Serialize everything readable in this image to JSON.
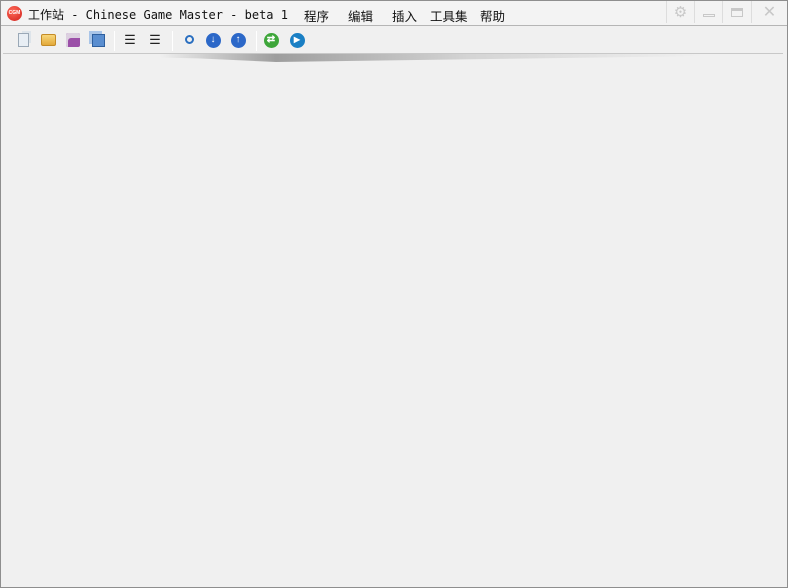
{
  "app": {
    "logo_text": "CGM",
    "title": "工作站 - Chinese Game Master - beta 1"
  },
  "menu": [
    "程序",
    "编辑",
    "插入",
    "工具集",
    "帮助"
  ],
  "window_controls": [
    "settings-icon",
    "minimize-icon",
    "maximize-icon",
    "close-icon"
  ],
  "toolbar": [
    "new-document-icon",
    "open-folder-icon",
    "save-icon",
    "save-all-icon",
    "indent-icon",
    "outdent-icon",
    "search-icon",
    "move-down-icon",
    "move-up-icon",
    "refresh-icon",
    "run-icon"
  ]
}
